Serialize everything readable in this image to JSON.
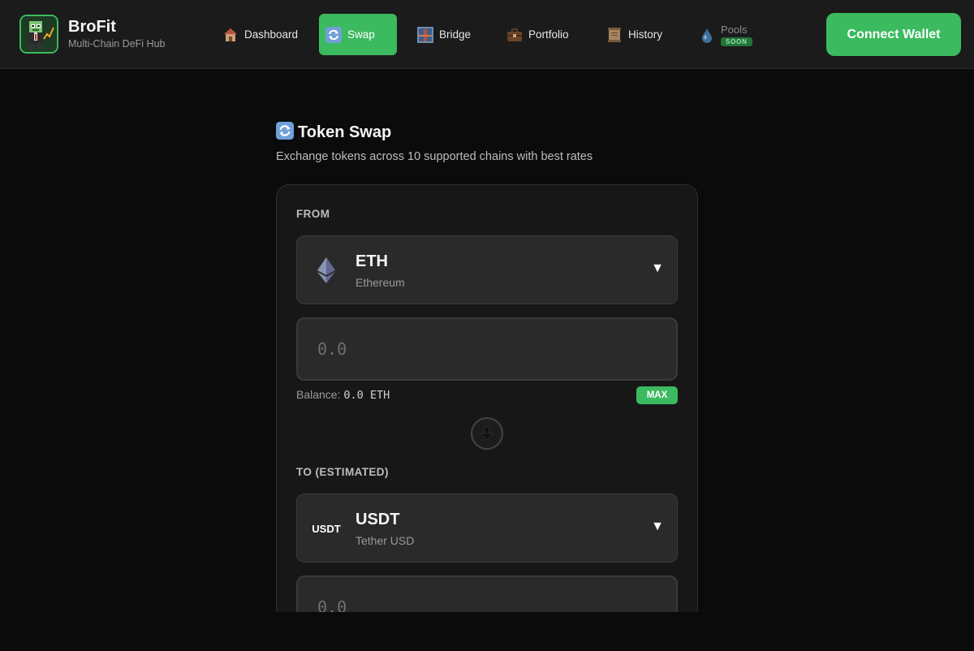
{
  "brand": {
    "name": "BroFit",
    "tagline": "Multi-Chain DeFi Hub"
  },
  "nav": {
    "items": [
      {
        "label": "Dashboard",
        "icon": "house-icon",
        "active": false
      },
      {
        "label": "Swap",
        "icon": "swap-arrows-icon",
        "active": true
      },
      {
        "label": "Bridge",
        "icon": "bridge-icon",
        "active": false
      },
      {
        "label": "Portfolio",
        "icon": "briefcase-icon",
        "active": false
      },
      {
        "label": "History",
        "icon": "scroll-icon",
        "active": false
      },
      {
        "label": "Pools",
        "icon": "droplet-icon",
        "active": false,
        "badge": "SOON"
      }
    ]
  },
  "connect_wallet": "Connect Wallet",
  "page": {
    "title": "Token Swap",
    "subtitle": "Exchange tokens across 10 supported chains with best rates"
  },
  "swap": {
    "from": {
      "label": "FROM",
      "token_symbol": "ETH",
      "token_name": "Ethereum",
      "amount_placeholder": "0.0",
      "balance_label": "Balance:",
      "balance_value": "0.0 ETH",
      "max_label": "MAX"
    },
    "to": {
      "label": "TO (ESTIMATED)",
      "token_symbol": "USDT",
      "token_name": "Tether USD",
      "token_icon_text": "USDT",
      "amount_placeholder": "0.0"
    },
    "caret": "▼"
  },
  "colors": {
    "accent": "#3cba5f",
    "background": "#0b0b0b",
    "header": "#1b1b1b",
    "card": "#171717",
    "field": "#2a2a2a"
  }
}
